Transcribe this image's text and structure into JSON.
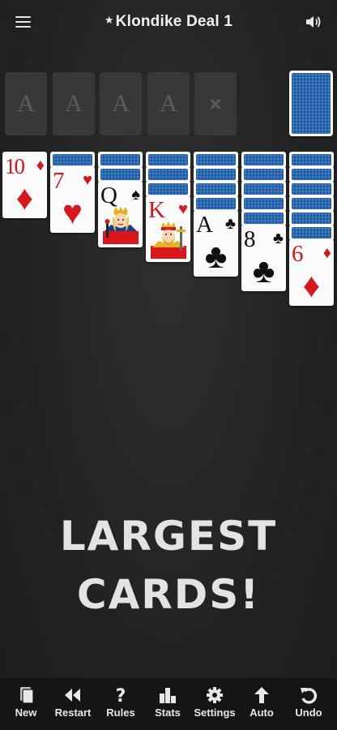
{
  "header": {
    "title_star": "★",
    "title": "Klondike Deal 1",
    "menu_icon": "hamburger-menu-icon",
    "sound_icon": "speaker-icon"
  },
  "foundations": [
    {
      "placeholder": "A"
    },
    {
      "placeholder": "A"
    },
    {
      "placeholder": "A"
    },
    {
      "placeholder": "A"
    }
  ],
  "waste": {
    "placeholder": "×"
  },
  "tableau": [
    {
      "hidden_cards": 0,
      "top_card": {
        "rank": "10",
        "suit": "♦",
        "color": "red"
      }
    },
    {
      "hidden_cards": 1,
      "top_card": {
        "rank": "7",
        "suit": "♥",
        "color": "red"
      }
    },
    {
      "hidden_cards": 2,
      "top_card": {
        "rank": "Q",
        "suit": "♠",
        "color": "black"
      }
    },
    {
      "hidden_cards": 3,
      "top_card": {
        "rank": "K",
        "suit": "♥",
        "color": "red"
      }
    },
    {
      "hidden_cards": 4,
      "top_card": {
        "rank": "A",
        "suit": "♣",
        "color": "black"
      }
    },
    {
      "hidden_cards": 5,
      "top_card": {
        "rank": "8",
        "suit": "♣",
        "color": "black"
      }
    },
    {
      "hidden_cards": 6,
      "top_card": {
        "rank": "6",
        "suit": "♦",
        "color": "red"
      }
    }
  ],
  "promo": {
    "line1": "LARGEST",
    "line2": "CARDS!"
  },
  "toolbar": {
    "new": "New",
    "restart": "Restart",
    "rules": "Rules",
    "stats": "Stats",
    "settings": "Settings",
    "auto": "Auto",
    "undo": "Undo"
  },
  "colors": {
    "card_back": "#1f5ea8",
    "red_suit": "#d9161c",
    "background": "#232323"
  }
}
